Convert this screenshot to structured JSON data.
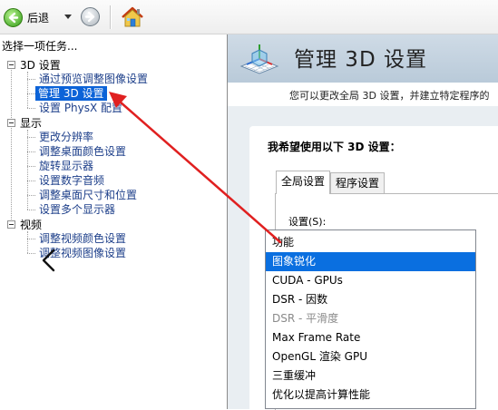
{
  "toolbar": {
    "back_label": "后退",
    "icons": {
      "back": "back-arrow-icon",
      "dropdown": "chevron-down-icon",
      "forward": "forward-arrow-icon",
      "home": "home-icon"
    }
  },
  "left_panel": {
    "task_header": "选择一项任务...",
    "categories": [
      {
        "label": "3D 设置",
        "items": [
          {
            "label": "通过预览调整图像设置"
          },
          {
            "label": "管理 3D 设置",
            "selected": true
          },
          {
            "label": "设置 PhysX 配置"
          }
        ]
      },
      {
        "label": "显示",
        "items": [
          {
            "label": "更改分辨率"
          },
          {
            "label": "调整桌面颜色设置"
          },
          {
            "label": "旋转显示器"
          },
          {
            "label": "设置数字音频"
          },
          {
            "label": "调整桌面尺寸和位置"
          },
          {
            "label": "设置多个显示器"
          }
        ]
      },
      {
        "label": "视频",
        "items": [
          {
            "label": "调整视频颜色设置"
          },
          {
            "label": "调整视频图像设置"
          }
        ]
      }
    ]
  },
  "right_panel": {
    "title": "管理 3D 设置",
    "subtitle": "您可以更改全局 3D 设置，并建立特定程序的",
    "heading": "我希望使用以下 3D 设置：",
    "tabs": [
      {
        "label": "全局设置",
        "active": true
      },
      {
        "label": "程序设置",
        "active": false
      }
    ],
    "settings_label": "设置(S):",
    "list_header": "功能",
    "settings": [
      {
        "label": "图象锐化",
        "state": "selected"
      },
      {
        "label": "CUDA - GPUs",
        "state": "normal"
      },
      {
        "label": "DSR - 因数",
        "state": "normal"
      },
      {
        "label": "DSR - 平滑度",
        "state": "disabled"
      },
      {
        "label": "Max Frame Rate",
        "state": "normal"
      },
      {
        "label": "OpenGL 渲染 GPU",
        "state": "normal"
      },
      {
        "label": "三重缓冲",
        "state": "normal"
      },
      {
        "label": "优化以提高计算性能",
        "state": "normal"
      }
    ]
  },
  "colors": {
    "selection": "#0c63d8",
    "link_text": "#1d3f8a",
    "annotation_arrow": "#e02020"
  }
}
